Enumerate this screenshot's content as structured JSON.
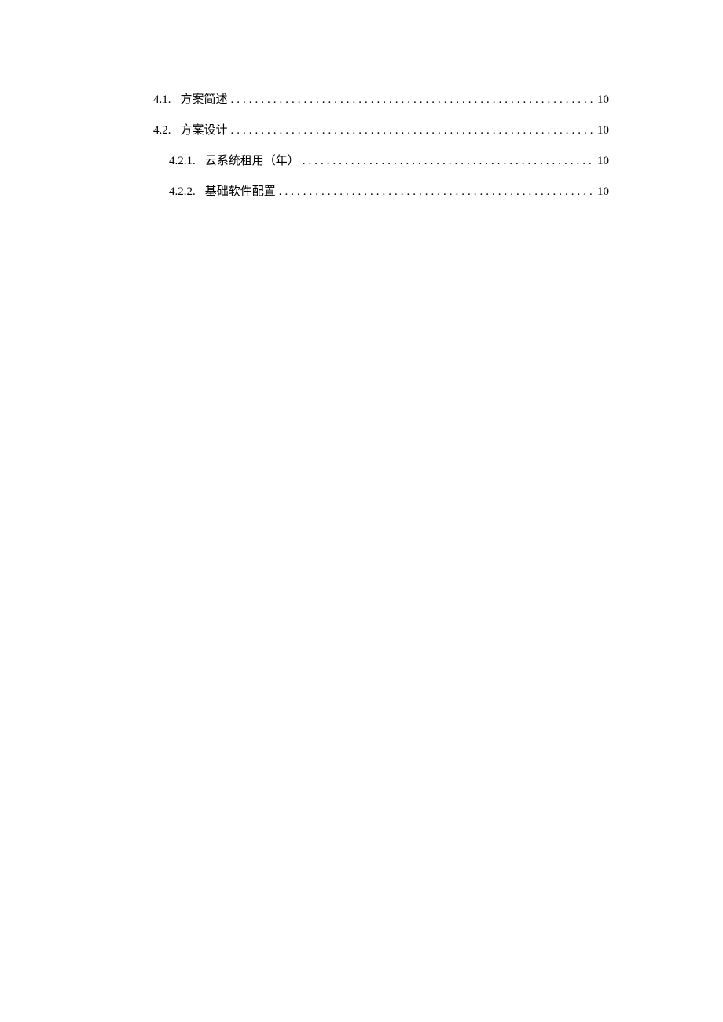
{
  "toc": [
    {
      "level": 2,
      "number": "4.1.",
      "title": "方案简述",
      "page": "10"
    },
    {
      "level": 2,
      "number": "4.2.",
      "title": "方案设计",
      "page": "10"
    },
    {
      "level": 3,
      "number": "4.2.1.",
      "title": "云系统租用（年）",
      "page": "10"
    },
    {
      "level": 3,
      "number": "4.2.2.",
      "title": "基础软件配置",
      "page": "10"
    }
  ]
}
